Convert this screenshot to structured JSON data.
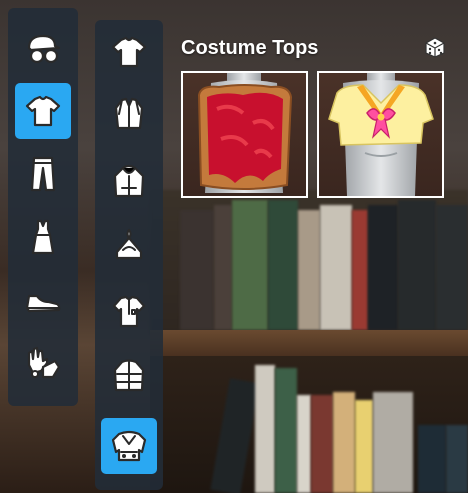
{
  "panel": {
    "title": "Costume Tops"
  },
  "icons": {
    "random": "dice-icon"
  },
  "categories": [
    {
      "id": "headwear",
      "icon": "hat-glasses-icon",
      "active": false
    },
    {
      "id": "tops",
      "icon": "tshirt-icon",
      "active": true
    },
    {
      "id": "bottoms",
      "icon": "pants-icon",
      "active": false
    },
    {
      "id": "dress",
      "icon": "dress-icon",
      "active": false
    },
    {
      "id": "shoes",
      "icon": "sneaker-icon",
      "active": false
    },
    {
      "id": "accessories",
      "icon": "gloves-icon",
      "active": false
    }
  ],
  "subcategories": [
    {
      "id": "t-shirt",
      "icon": "tshirt-icon",
      "active": false
    },
    {
      "id": "shirt",
      "icon": "dress-shirt-icon",
      "active": false
    },
    {
      "id": "hoodie",
      "icon": "hoodie-icon",
      "active": false
    },
    {
      "id": "halter",
      "icon": "halter-top-icon",
      "active": false
    },
    {
      "id": "button-shirt",
      "icon": "polo-shirt-icon",
      "active": false
    },
    {
      "id": "puffer",
      "icon": "puffer-jacket-icon",
      "active": false
    },
    {
      "id": "costume",
      "icon": "costume-top-icon",
      "active": true
    }
  ],
  "items": [
    {
      "id": "toast-top",
      "name": "toast-costume-top"
    },
    {
      "id": "sailor-top",
      "name": "sailor-uniform-top"
    }
  ],
  "colors": {
    "accent": "#2aa8f2",
    "panel": "#222c38"
  }
}
